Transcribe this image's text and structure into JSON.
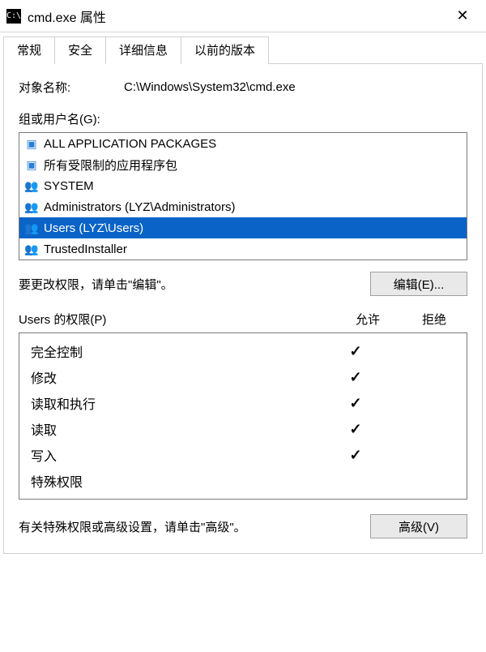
{
  "window": {
    "title": "cmd.exe 属性"
  },
  "tabs": {
    "general": "常规",
    "security": "安全",
    "details": "详细信息",
    "previous": "以前的版本",
    "active": "security"
  },
  "objectName": {
    "label": "对象名称:",
    "value": "C:\\Windows\\System32\\cmd.exe"
  },
  "groupUsers": {
    "label": "组或用户名(G):",
    "items": [
      {
        "icon": "pkg",
        "name": "ALL APPLICATION PACKAGES",
        "selected": false
      },
      {
        "icon": "pkg",
        "name": "所有受限制的应用程序包",
        "selected": false
      },
      {
        "icon": "user",
        "name": "SYSTEM",
        "selected": false
      },
      {
        "icon": "user",
        "name": "Administrators (LYZ\\Administrators)",
        "selected": false
      },
      {
        "icon": "user",
        "name": "Users (LYZ\\Users)",
        "selected": true
      },
      {
        "icon": "user",
        "name": "TrustedInstaller",
        "selected": false
      }
    ]
  },
  "editHint": "要更改权限，请单击\"编辑\"。",
  "buttons": {
    "edit": "编辑(E)...",
    "advanced": "高级(V)"
  },
  "permissions": {
    "headerName": "Users 的权限(P)",
    "colAllow": "允许",
    "colDeny": "拒绝",
    "rows": [
      {
        "name": "完全控制",
        "allow": true,
        "deny": false
      },
      {
        "name": "修改",
        "allow": true,
        "deny": false
      },
      {
        "name": "读取和执行",
        "allow": true,
        "deny": false
      },
      {
        "name": "读取",
        "allow": true,
        "deny": false
      },
      {
        "name": "写入",
        "allow": true,
        "deny": false
      },
      {
        "name": "特殊权限",
        "allow": false,
        "deny": false
      }
    ]
  },
  "advancedHint": "有关特殊权限或高级设置，请单击\"高级\"。"
}
